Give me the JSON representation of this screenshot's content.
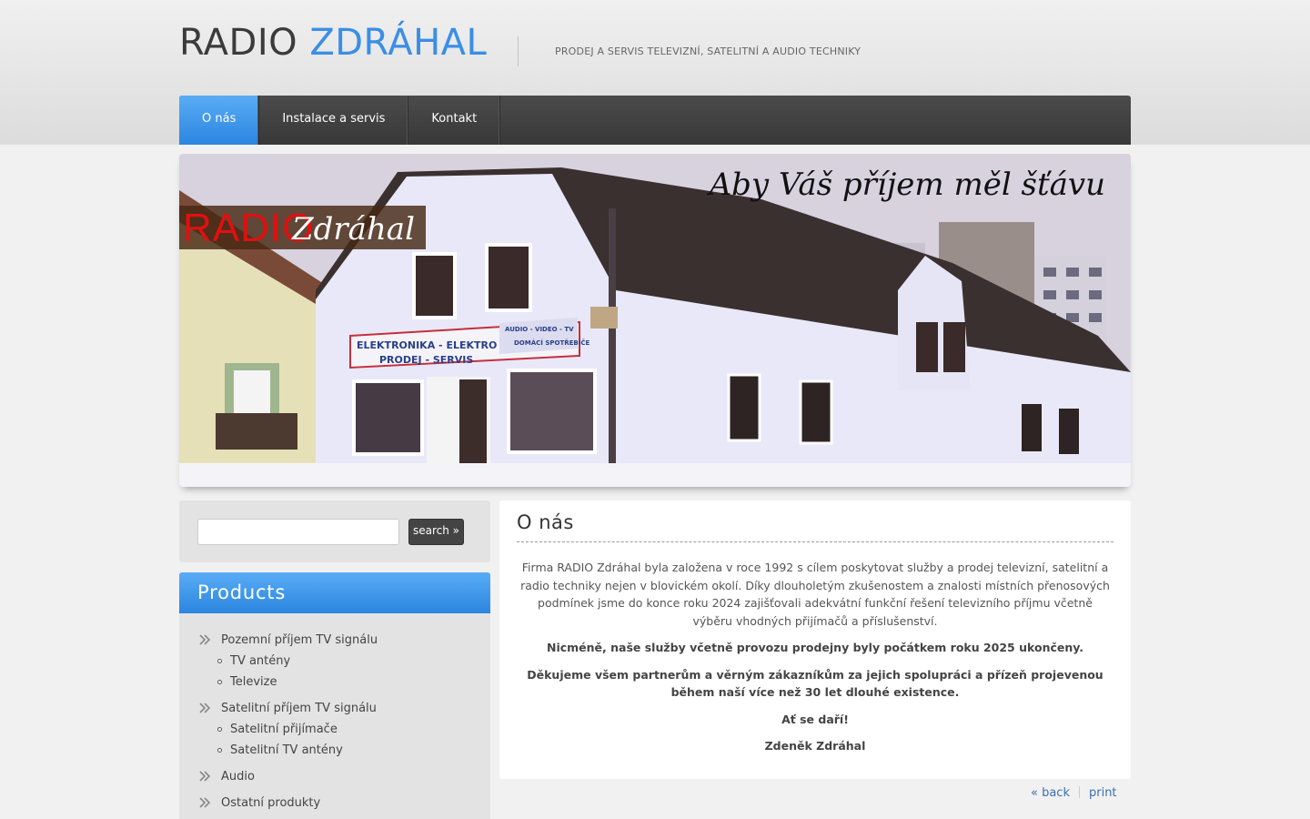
{
  "header": {
    "logo_part1": "RADIO",
    "logo_part2": "ZDRÁHAL",
    "tagline": "PRODEJ A SERVIS TELEVIZNÍ, SATELITNÍ A AUDIO TECHNIKY"
  },
  "nav": {
    "items": [
      {
        "label": "O nás",
        "active": true
      },
      {
        "label": "Instalace a servis",
        "active": false
      },
      {
        "label": "Kontakt",
        "active": false
      }
    ]
  },
  "banner": {
    "slogan": "Aby Váš příjem měl šťávu",
    "logo_radio": "RADIO",
    "logo_name": "Zdráhal",
    "sign_line1": "ELEKTRONIKA - ELEKTRO",
    "sign_line2": "PRODEJ - SERVIS",
    "sign_line3": "AUDIO - VIDEO - TV",
    "sign_line4": "DOMÁCÍ SPOTŘEBIČE"
  },
  "search": {
    "placeholder": "",
    "button_label": "search »"
  },
  "products": {
    "title": "Products",
    "categories": [
      {
        "label": "Pozemní příjem TV signálu",
        "sub": [
          "TV antény",
          "Televize"
        ]
      },
      {
        "label": "Satelitní příjem TV signálu",
        "sub": [
          "Satelitní přijímače",
          "Satelitní TV antény"
        ]
      },
      {
        "label": "Audio",
        "sub": []
      },
      {
        "label": "Ostatní produkty",
        "sub": []
      }
    ]
  },
  "content": {
    "title": "O nás",
    "paragraph1": "Firma RADIO Zdráhal byla založena v roce 1992 s cílem poskytovat služby a prodej televizní, satelitní a radio techniky nejen v blovickém okolí. Díky dlouholetým zkušenostem a znalosti místních přenosových podmínek jsme do konce roku 2024 zajišťovali adekvátní funkční řešení televizního příjmu včetně výběru vhodných přijímačů a příslušenství.",
    "paragraph2": "Nicméně, naše služby včetně provozu prodejny byly počátkem roku 2025 ukončeny.",
    "paragraph3": "Děkujeme všem partnerům a věrným zákazníkům za jejich spolupráci a přízeň projevenou během naší více než 30 let dlouhé existence.",
    "paragraph4": "Ať se daří!",
    "signature": "Zdeněk Zdráhal"
  },
  "footer_links": {
    "back": "« back",
    "print": "print"
  },
  "colors": {
    "accent": "#3a8ee6",
    "nav_dark": "#404040",
    "page_bg": "#f1f1f1"
  }
}
